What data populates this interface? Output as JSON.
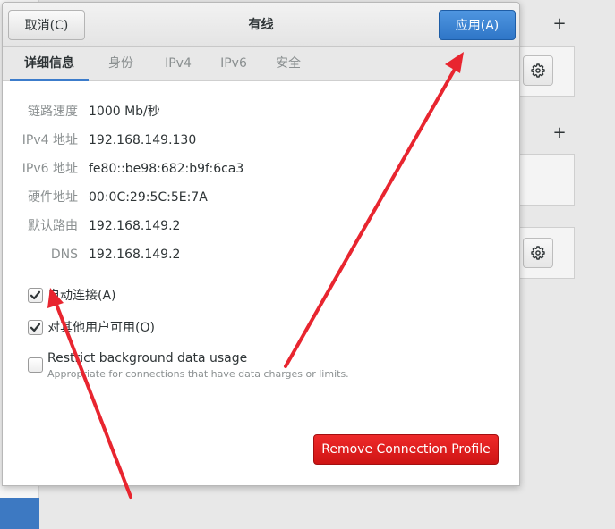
{
  "dialog": {
    "title": "有线",
    "cancel_label": "取消(C)",
    "apply_label": "应用(A)"
  },
  "tabs": [
    {
      "label": "详细信息",
      "active": true
    },
    {
      "label": "身份",
      "active": false
    },
    {
      "label": "IPv4",
      "active": false
    },
    {
      "label": "IPv6",
      "active": false
    },
    {
      "label": "安全",
      "active": false
    }
  ],
  "details": [
    {
      "label": "链路速度",
      "value": "1000 Mb/秒"
    },
    {
      "label": "IPv4 地址",
      "value": "192.168.149.130"
    },
    {
      "label": "IPv6 地址",
      "value": "fe80::be98:682:b9f:6ca3"
    },
    {
      "label": "硬件地址",
      "value": "00:0C:29:5C:5E:7A"
    },
    {
      "label": "默认路由",
      "value": "192.168.149.2"
    },
    {
      "label": "DNS",
      "value": "192.168.149.2"
    }
  ],
  "options": {
    "auto_connect": {
      "label": "自动连接(A)",
      "checked": true
    },
    "all_users": {
      "label": "对其他用户可用(O)",
      "checked": true
    },
    "restrict_data": {
      "label": "Restrict background data usage",
      "sub": "Appropriate for connections that have data charges or limits.",
      "checked": false
    }
  },
  "remove_label": "Remove Connection Profile",
  "background": {
    "plus_1": "+",
    "plus_2": "+"
  },
  "colors": {
    "apply": "#3479cf",
    "remove": "#df1d1d",
    "arrow": "#e8252f",
    "tab_indicator": "#3c7ccb"
  },
  "icons": {
    "gear": "gear-icon",
    "check": "checkmark-icon"
  }
}
